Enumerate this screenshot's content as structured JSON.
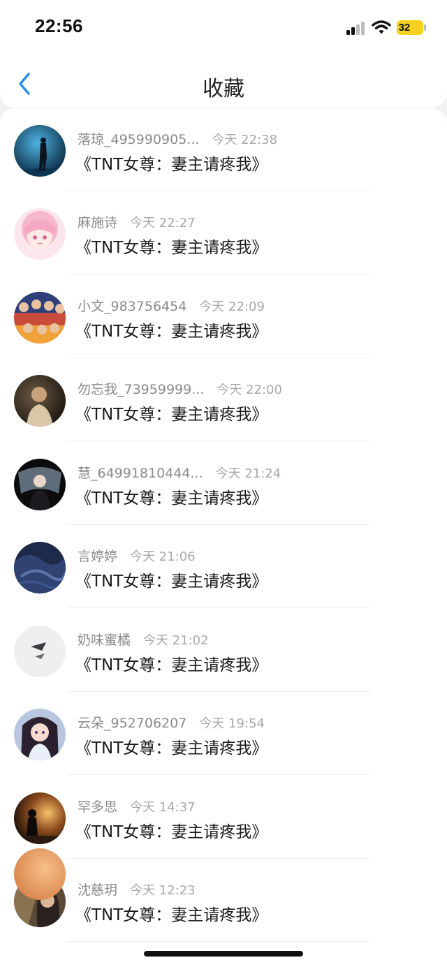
{
  "status_bar": {
    "time": "22:56",
    "battery": "32",
    "icons": [
      "cellular-signal-icon",
      "wifi-icon",
      "battery-charging-icon"
    ]
  },
  "nav": {
    "back_icon": "chevron-left-icon",
    "title": "收藏"
  },
  "colors": {
    "accent": "#2c8ee8",
    "battery": "#f5d21e",
    "username": "#8a8a8f",
    "timestamp": "#a8a8ad",
    "title_text": "#1a1a1a"
  },
  "items": [
    {
      "user": "落琼_495990905...",
      "time": "今天 22:38",
      "title": "《TNT女尊：妻主请疼我》",
      "avatar": "night-figure-avatar"
    },
    {
      "user": "麻施诗",
      "time": "今天 22:27",
      "title": "《TNT女尊：妻主请疼我》",
      "avatar": "pink-anime-girl-avatar"
    },
    {
      "user": "小文_983756454",
      "time": "今天 22:09",
      "title": "《TNT女尊：妻主请疼我》",
      "avatar": "group-photo-avatar"
    },
    {
      "user": "勿忘我_73959999...",
      "time": "今天 22:00",
      "title": "《TNT女尊：妻主请疼我》",
      "avatar": "dark-portrait-avatar"
    },
    {
      "user": "慧_64991810444...",
      "time": "今天 21:24",
      "title": "《TNT女尊：妻主请疼我》",
      "avatar": "girl-with-veil-avatar"
    },
    {
      "user": "言婷婷",
      "time": "今天 21:06",
      "title": "《TNT女尊：妻主请疼我》",
      "avatar": "blue-fabric-avatar"
    },
    {
      "user": "奶味蜜橘",
      "time": "今天 21:02",
      "title": "《TNT女尊：妻主请疼我》",
      "avatar": "paper-plane-avatar"
    },
    {
      "user": "云朵_952706207",
      "time": "今天 19:54",
      "title": "《TNT女尊：妻主请疼我》",
      "avatar": "anime-girl-avatar"
    },
    {
      "user": "罕多思",
      "time": "今天 14:37",
      "title": "《TNT女尊：妻主请疼我》",
      "avatar": "sunset-silhouette-avatar"
    },
    {
      "user": "沈慈玥",
      "time": "今天 12:23",
      "title": "《TNT女尊：妻主请疼我》",
      "avatar": "portrait-avatar"
    }
  ]
}
